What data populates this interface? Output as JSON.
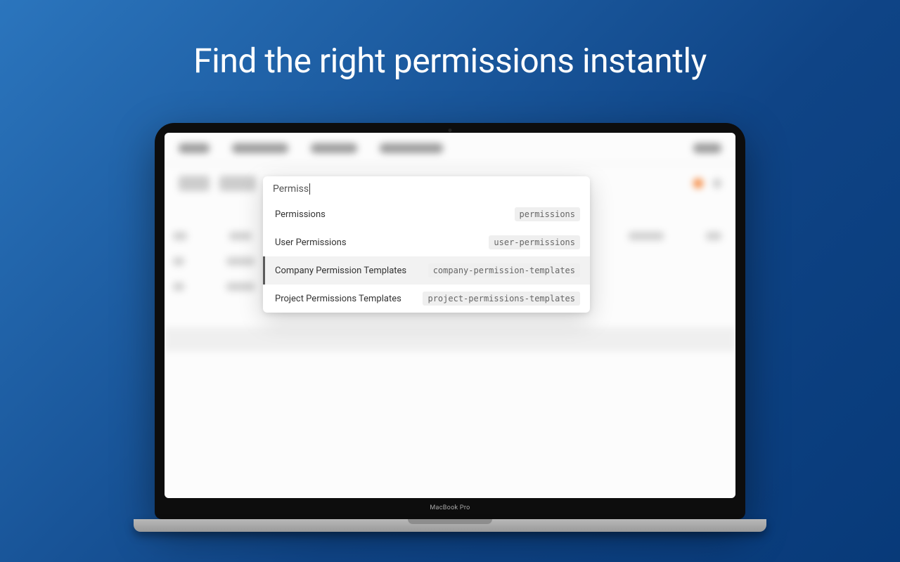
{
  "hero": {
    "title": "Find the right permissions instantly"
  },
  "device": {
    "label": "MacBook Pro"
  },
  "popover": {
    "query": "Permiss",
    "results": [
      {
        "label": "Permissions",
        "slug": "permissions",
        "selected": false
      },
      {
        "label": "User Permissions",
        "slug": "user-permissions",
        "selected": false
      },
      {
        "label": "Company Permission Templates",
        "slug": "company-permission-templates",
        "selected": true
      },
      {
        "label": "Project Permissions Templates",
        "slug": "project-permissions-templates",
        "selected": false
      }
    ]
  }
}
